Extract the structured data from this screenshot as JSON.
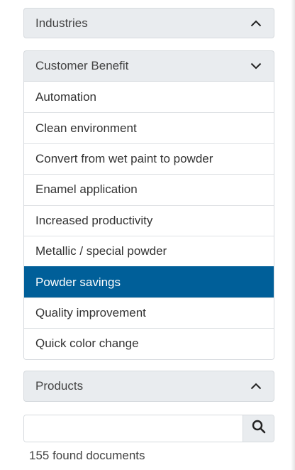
{
  "filters": {
    "industries": {
      "label": "Industries",
      "state": "collapsed",
      "icon": "chevron-up-icon"
    },
    "customer_benefit": {
      "label": "Customer Benefit",
      "state": "expanded",
      "icon": "chevron-down-icon",
      "items": [
        {
          "label": "Automation",
          "selected": false
        },
        {
          "label": "Clean environment",
          "selected": false
        },
        {
          "label": "Convert from wet paint to powder",
          "selected": false
        },
        {
          "label": "Enamel application",
          "selected": false
        },
        {
          "label": "Increased productivity",
          "selected": false
        },
        {
          "label": "Metallic / special powder",
          "selected": false
        },
        {
          "label": "Powder savings",
          "selected": true
        },
        {
          "label": "Quality improvement",
          "selected": false
        },
        {
          "label": "Quick color change",
          "selected": false
        }
      ]
    },
    "products": {
      "label": "Products",
      "state": "collapsed",
      "icon": "chevron-up-icon"
    }
  },
  "search": {
    "value": "",
    "placeholder": "",
    "icon": "search-icon"
  },
  "results": {
    "found_text": "155 found documents"
  },
  "colors": {
    "active_item_bg": "#005f99",
    "header_bg": "#e9ecef"
  }
}
